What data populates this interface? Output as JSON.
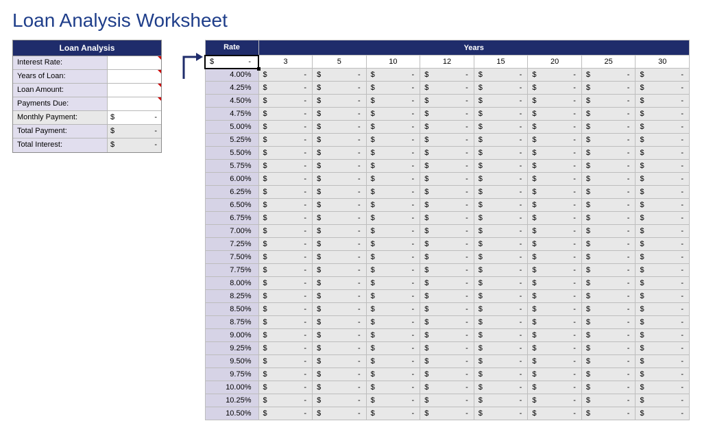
{
  "title": "Loan Analysis Worksheet",
  "loan_panel": {
    "header": "Loan Analysis",
    "rows": [
      {
        "label": "Interest Rate:",
        "value": "",
        "label_bg": "lav",
        "val_bg": "white",
        "marker": true
      },
      {
        "label": "Years of Loan:",
        "value": "",
        "label_bg": "lav",
        "val_bg": "white",
        "marker": true
      },
      {
        "label": "Loan Amount:",
        "value": "",
        "label_bg": "lav",
        "val_bg": "white",
        "marker": true
      },
      {
        "label": "Payments Due:",
        "value": "",
        "label_bg": "lav",
        "val_bg": "white",
        "marker": true
      },
      {
        "label": "Monthly Payment:",
        "value": "-",
        "label_bg": "grey",
        "val_bg": "white",
        "currency": true
      },
      {
        "label": "Total Payment:",
        "value": "-",
        "label_bg": "lav",
        "val_bg": "grey",
        "currency": true
      },
      {
        "label": "Total Interest:",
        "value": "-",
        "label_bg": "lav",
        "val_bg": "grey",
        "currency": true
      }
    ]
  },
  "matrix": {
    "rate_header": "Rate",
    "years_header": "Years",
    "corner_value": "-",
    "corner_currency": true,
    "years": [
      3,
      5,
      10,
      12,
      15,
      20,
      25,
      30
    ],
    "rates": [
      "4.00%",
      "4.25%",
      "4.50%",
      "4.75%",
      "5.00%",
      "5.25%",
      "5.50%",
      "5.75%",
      "6.00%",
      "6.25%",
      "6.50%",
      "6.75%",
      "7.00%",
      "7.25%",
      "7.50%",
      "7.75%",
      "8.00%",
      "8.25%",
      "8.50%",
      "8.75%",
      "9.00%",
      "9.25%",
      "9.50%",
      "9.75%",
      "10.00%",
      "10.25%",
      "10.50%"
    ],
    "cell_value": "-",
    "cell_currency": true
  },
  "colors": {
    "navy": "#1f2c6b",
    "lavender": "#d6d3e6",
    "lavender_light": "#e1deee",
    "grey": "#e8e8e8"
  }
}
